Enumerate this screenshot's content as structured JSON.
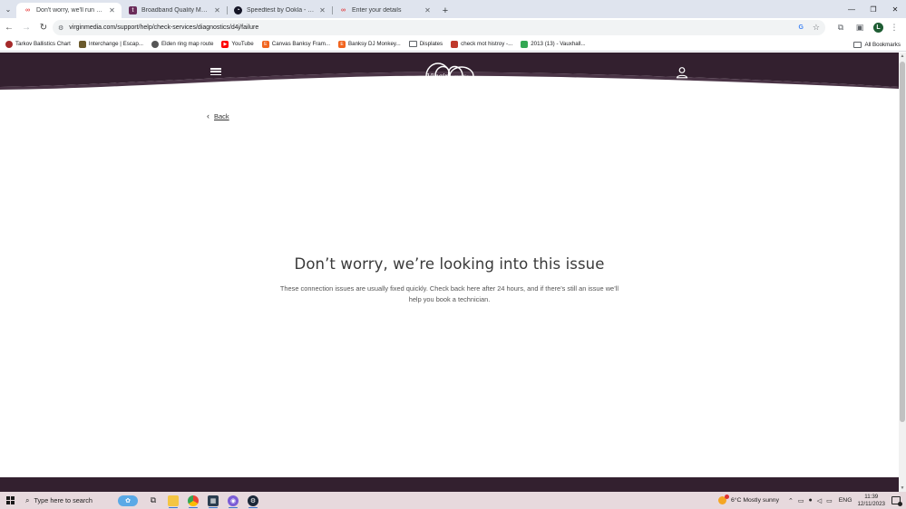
{
  "browser": {
    "tabs": [
      {
        "title": "Don't worry, we'll run some fu",
        "favicon": "virgin-media-favicon",
        "active": true
      },
      {
        "title": "Broadband Quality Monitor | th",
        "favicon": "thinkbroadband-favicon",
        "active": false
      },
      {
        "title": "Speedtest by Ookla - The Glob",
        "favicon": "speedtest-favicon",
        "active": false
      },
      {
        "title": "Enter your details",
        "favicon": "virgin-media-favicon",
        "active": false
      }
    ],
    "url": "virginmedia.com/support/help/check-services/diagnostics/d4j/failure",
    "profile_initial": "L",
    "bookmarks": [
      {
        "label": "Tarkov Ballistics Chart",
        "icon": "tarkov-icon",
        "color": "#a52a2a"
      },
      {
        "label": "Interchange | Escap...",
        "icon": "map-icon",
        "color": "#6b5a2c"
      },
      {
        "label": "Elden ring map route",
        "icon": "globe-icon",
        "color": "#555555"
      },
      {
        "label": "YouTube",
        "icon": "youtube-icon",
        "color": "#ff0000"
      },
      {
        "label": "Canvas Banksy Fram...",
        "icon": "etsy-icon",
        "color": "#f1641e"
      },
      {
        "label": "Banksy DJ Monkey...",
        "icon": "etsy-icon",
        "color": "#f1641e"
      },
      {
        "label": "Displates",
        "icon": "folder-icon",
        "color": "#5f6368"
      },
      {
        "label": "check mot histroy -...",
        "icon": "gov-icon",
        "color": "#c0392b"
      },
      {
        "label": "2013 (13) - Vauxhall...",
        "icon": "sheet-icon",
        "color": "#34a853"
      }
    ],
    "all_bookmarks_label": "All Bookmarks"
  },
  "page": {
    "brand": {
      "logo_script": "Virgin",
      "logo_word": "media"
    },
    "back_label": "Back",
    "headline": "Don’t worry, we’re looking into this issue",
    "body": "These connection issues are usually fixed quickly. Check back here after 24 hours, and if there’s still an issue we’ll help you book a technician.",
    "colors": {
      "header": "#33202f",
      "text": "#3a3a3a"
    }
  },
  "taskbar": {
    "search_placeholder": "Type here to search",
    "weather": "6°C  Mostly sunny",
    "language": "ENG",
    "time": "11:39",
    "date": "12/11/2023"
  }
}
